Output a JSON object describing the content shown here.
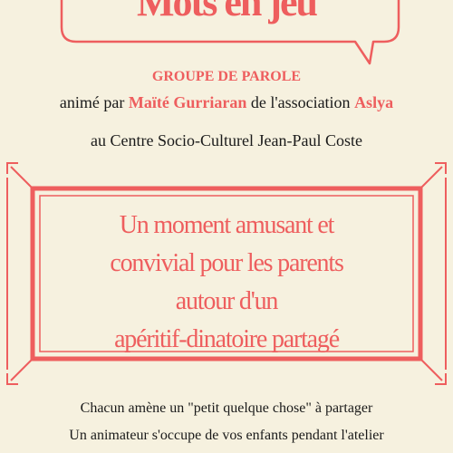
{
  "colors": {
    "accent": "#ee5e5e",
    "background": "#f6f1df",
    "text": "#1a1a1a"
  },
  "header": {
    "title": "Mots en jeu"
  },
  "group": {
    "label": "GROUPE DE PAROLE",
    "host_prefix": "animé par",
    "host_name": "Maïté Gurriaran",
    "host_middle": "de l'association",
    "association": "Aslya",
    "venue": "au Centre Socio-Culturel Jean-Paul Coste"
  },
  "highlight": {
    "lines": [
      "Un moment amusant et",
      "convivial pour les parents",
      "autour d'un",
      "apéritif-dinatoire partagé"
    ]
  },
  "info": {
    "line1": "Chacun amène un \"petit quelque chose\" à partager",
    "line2": "Un animateur s'occupe de vos enfants pendant l'atelier"
  }
}
